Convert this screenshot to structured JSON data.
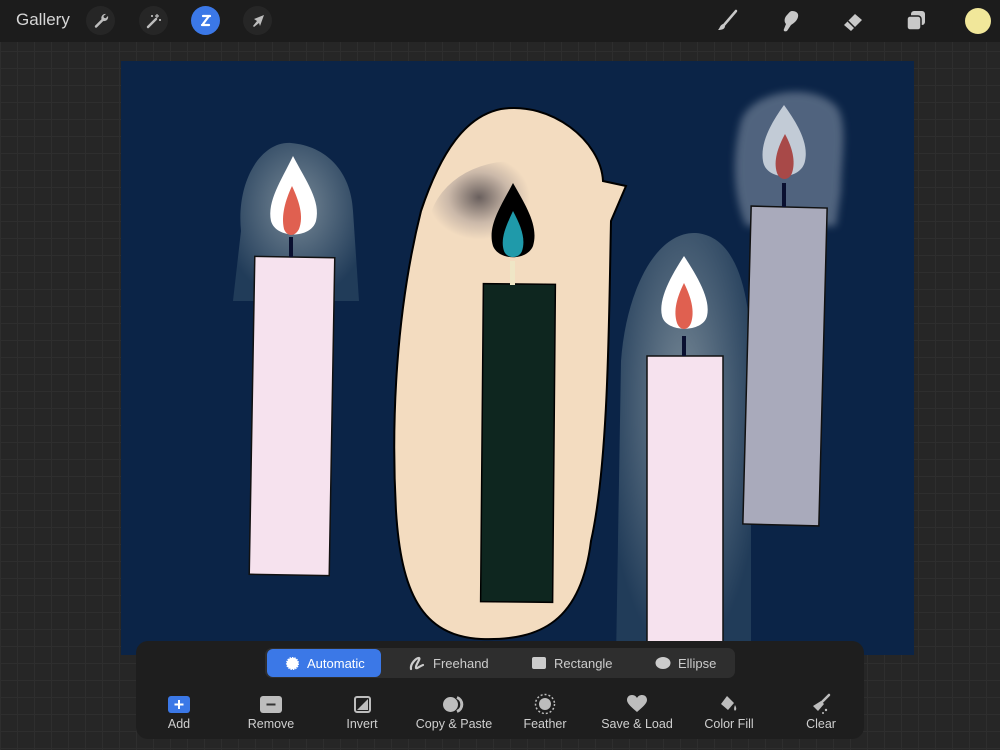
{
  "topbar": {
    "gallery_label": "Gallery",
    "left_tools": [
      {
        "name": "actions",
        "icon": "wrench-icon",
        "active": false
      },
      {
        "name": "adjustments",
        "icon": "magic-wand-icon",
        "active": false
      },
      {
        "name": "selection",
        "icon": "selection-s-icon",
        "active": true
      },
      {
        "name": "transform",
        "icon": "arrow-cursor-icon",
        "active": false
      }
    ],
    "right_tools": [
      {
        "name": "brush",
        "icon": "brush-icon"
      },
      {
        "name": "smudge",
        "icon": "smudge-finger-icon"
      },
      {
        "name": "eraser",
        "icon": "eraser-icon"
      },
      {
        "name": "layers",
        "icon": "layers-icon"
      }
    ],
    "current_color": "#f1e79a",
    "accent_color": "#3b78e7"
  },
  "canvas": {
    "background_color": "#0b2447",
    "artwork": "Four candles on dark navy background"
  },
  "selection_panel": {
    "modes": [
      {
        "label": "Automatic",
        "icon": "automatic-burst-icon",
        "active": true
      },
      {
        "label": "Freehand",
        "icon": "freehand-icon",
        "active": false
      },
      {
        "label": "Rectangle",
        "icon": "rectangle-icon",
        "active": false
      },
      {
        "label": "Ellipse",
        "icon": "ellipse-icon",
        "active": false
      }
    ],
    "actions": [
      {
        "label": "Add",
        "icon": "add-icon"
      },
      {
        "label": "Remove",
        "icon": "remove-icon"
      },
      {
        "label": "Invert",
        "icon": "invert-icon"
      },
      {
        "label": "Copy & Paste",
        "icon": "copy-paste-icon"
      },
      {
        "label": "Feather",
        "icon": "feather-icon"
      },
      {
        "label": "Save & Load",
        "icon": "heart-icon"
      },
      {
        "label": "Color Fill",
        "icon": "color-fill-icon"
      },
      {
        "label": "Clear",
        "icon": "clear-brush-icon"
      }
    ]
  }
}
